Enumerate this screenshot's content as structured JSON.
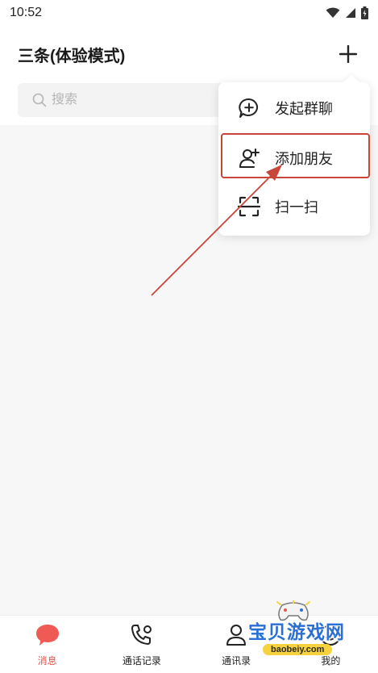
{
  "status_bar": {
    "time": "10:52"
  },
  "header": {
    "title": "三条(体验模式)"
  },
  "search": {
    "placeholder": "搜索"
  },
  "dropdown": {
    "items": [
      {
        "label": "发起群聊",
        "icon": "chat-plus-icon"
      },
      {
        "label": "添加朋友",
        "icon": "add-user-icon",
        "highlighted": true
      },
      {
        "label": "扫一扫",
        "icon": "scan-icon"
      }
    ]
  },
  "tabbar": {
    "items": [
      {
        "label": "消息",
        "icon": "message-bubble-icon",
        "active": true
      },
      {
        "label": "通话记录",
        "icon": "phone-call-icon"
      },
      {
        "label": "通讯录",
        "icon": "contacts-icon"
      },
      {
        "label": "我的",
        "icon": "profile-icon"
      }
    ]
  },
  "watermark": {
    "text": "宝贝游戏网",
    "url": "baobeiy.com"
  },
  "colors": {
    "accent": "#e8554e",
    "annotation": "#c9453a",
    "watermark_blue": "#2a6fd6"
  }
}
